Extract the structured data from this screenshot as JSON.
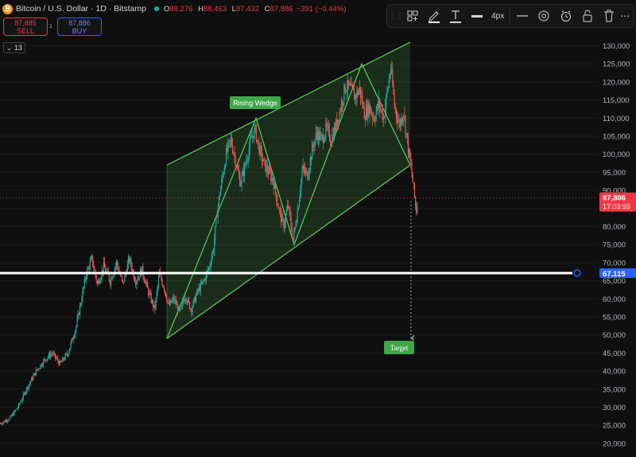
{
  "header": {
    "symbol": "Bitcoin / U.S. Dollar · 1D · Bitstamp",
    "open_label": "O",
    "open": "88,276",
    "high_label": "H",
    "high": "88,463",
    "low_label": "L",
    "low": "87,432",
    "close_label": "C",
    "close": "87,886",
    "change": "−391 (−0.44%)"
  },
  "trade": {
    "sell_price": "87,885",
    "sell_label": "SELL",
    "buy_price": "87,886",
    "buy_label": "BUY",
    "spread": "1",
    "collapse_label": "13"
  },
  "toolbar": {
    "items": [
      "layout-icon",
      "pencil-icon",
      "text-icon",
      "line-style-icon",
      "settings-icon",
      "alert-icon",
      "lock-icon",
      "trash-icon"
    ],
    "width_label": "4px"
  },
  "colors": {
    "up": "#26a69a",
    "down": "#ef5350",
    "wedge": "#58c558",
    "current": "#f23645",
    "hline": "#2962ff"
  },
  "chart_data": {
    "type": "candlestick",
    "title": "Bitcoin / U.S. Dollar · 1D · Bitstamp",
    "ylim": [
      18500,
      134500
    ],
    "yticks": [
      20000,
      25000,
      30000,
      35000,
      40000,
      45000,
      50000,
      55000,
      60000,
      65000,
      70000,
      75000,
      80000,
      85000,
      90000,
      95000,
      100000,
      105000,
      110000,
      115000,
      120000,
      125000,
      130000
    ],
    "price_path": [
      [
        0,
        25500
      ],
      [
        12,
        27000
      ],
      [
        22,
        30000
      ],
      [
        35,
        36000
      ],
      [
        45,
        40000
      ],
      [
        55,
        43000
      ],
      [
        65,
        45000
      ],
      [
        75,
        42000
      ],
      [
        85,
        45000
      ],
      [
        95,
        52000
      ],
      [
        102,
        60000
      ],
      [
        108,
        67000
      ],
      [
        115,
        71000
      ],
      [
        122,
        64000
      ],
      [
        130,
        69000
      ],
      [
        138,
        65000
      ],
      [
        146,
        70000
      ],
      [
        154,
        64000
      ],
      [
        162,
        71000
      ],
      [
        170,
        65000
      ],
      [
        178,
        68000
      ],
      [
        186,
        62000
      ],
      [
        194,
        57000
      ],
      [
        200,
        67000
      ],
      [
        206,
        63000
      ],
      [
        212,
        58000
      ],
      [
        218,
        60000
      ],
      [
        226,
        56000
      ],
      [
        232,
        61000
      ],
      [
        240,
        57000
      ],
      [
        248,
        62000
      ],
      [
        256,
        65000
      ],
      [
        263,
        69000
      ],
      [
        268,
        74000
      ],
      [
        273,
        85000
      ],
      [
        278,
        92000
      ],
      [
        284,
        100000
      ],
      [
        290,
        104000
      ],
      [
        296,
        98000
      ],
      [
        302,
        92000
      ],
      [
        308,
        97000
      ],
      [
        314,
        103000
      ],
      [
        320,
        107000
      ],
      [
        326,
        101000
      ],
      [
        332,
        97000
      ],
      [
        338,
        95000
      ],
      [
        344,
        92000
      ],
      [
        350,
        85000
      ],
      [
        356,
        80000
      ],
      [
        362,
        86000
      ],
      [
        368,
        76000
      ],
      [
        374,
        85000
      ],
      [
        380,
        96000
      ],
      [
        386,
        94000
      ],
      [
        392,
        101000
      ],
      [
        398,
        106000
      ],
      [
        404,
        104000
      ],
      [
        410,
        107000
      ],
      [
        416,
        104000
      ],
      [
        422,
        108000
      ],
      [
        428,
        113000
      ],
      [
        434,
        119000
      ],
      [
        440,
        118000
      ],
      [
        446,
        116000
      ],
      [
        452,
        118000
      ],
      [
        458,
        111000
      ],
      [
        464,
        113000
      ],
      [
        470,
        110000
      ],
      [
        476,
        114000
      ],
      [
        482,
        110000
      ],
      [
        487,
        118000
      ],
      [
        491,
        124000
      ],
      [
        496,
        113000
      ],
      [
        502,
        108000
      ],
      [
        507,
        112000
      ],
      [
        512,
        103000
      ],
      [
        516,
        97000
      ],
      [
        520,
        90000
      ],
      [
        523,
        84000
      ],
      [
        525,
        87886
      ]
    ],
    "current_price": "87,886",
    "countdown": "17:03:59",
    "horizontal_level": "67,115",
    "annotations": [
      {
        "text": "Rising Wedge"
      },
      {
        "text": "Target"
      }
    ],
    "wedge": {
      "upper": [
        [
          "day 210",
          97000
        ],
        [
          "day 516",
          131000
        ]
      ],
      "lower": [
        [
          "day 210",
          49000
        ],
        [
          "day 516",
          97000
        ]
      ],
      "zigzag": [
        [
          210,
          49000
        ],
        [
          322,
          110000
        ],
        [
          370,
          75000
        ],
        [
          455,
          125000
        ],
        [
          516,
          97000
        ]
      ],
      "target": 49000
    }
  }
}
